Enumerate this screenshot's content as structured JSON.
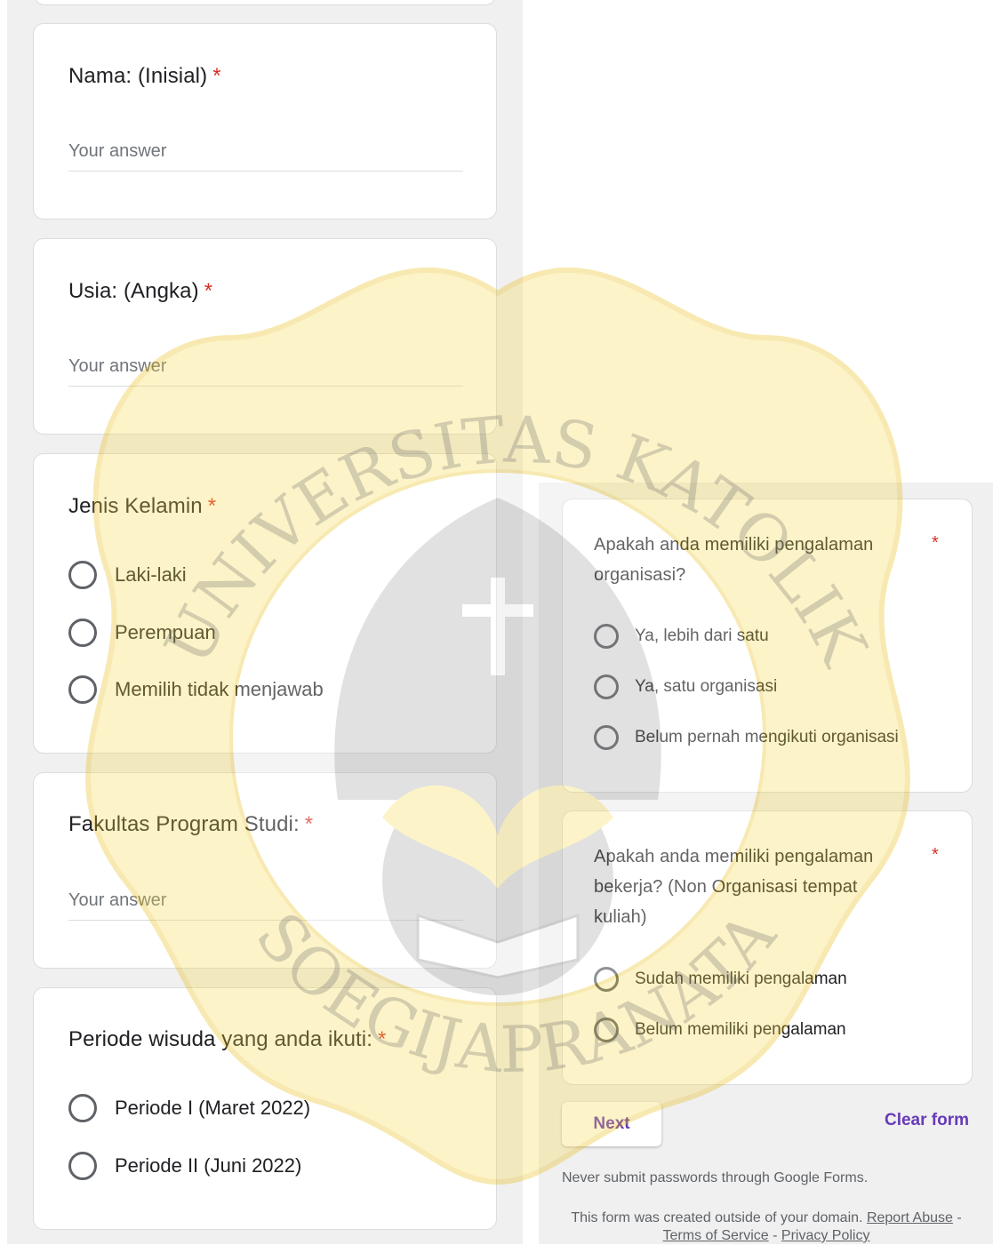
{
  "left": {
    "q_nama": {
      "title": "Nama: (Inisial)",
      "required": "*",
      "placeholder": "Your answer"
    },
    "q_usia": {
      "title": "Usia: (Angka)",
      "required": "*",
      "placeholder": "Your answer"
    },
    "q_jenis_kelamin": {
      "title": "Jenis Kelamin",
      "required": "*",
      "options": [
        "Laki-laki",
        "Perempuan",
        "Memilih tidak menjawab"
      ]
    },
    "q_fakultas": {
      "title": "Fakultas Program Studi:",
      "required": "*",
      "placeholder": "Your answer"
    },
    "q_periode": {
      "title": "Periode wisuda yang anda ikuti:",
      "required": "*",
      "options": [
        "Periode I (Maret 2022)",
        "Periode II (Juni 2022)"
      ]
    }
  },
  "right": {
    "q_organisasi": {
      "title_line1": "Apakah anda memiliki pengalaman",
      "title_line2": "organisasi?",
      "required": "*",
      "options": [
        "Ya, lebih dari satu",
        "Ya, satu organisasi",
        "Belum pernah mengikuti organisasi"
      ]
    },
    "q_bekerja": {
      "title_line1": "Apakah anda memiliki pengalaman",
      "title_line2": "bekerja? (Non Organisasi tempat",
      "title_line3": "kuliah)",
      "required": "*",
      "options": [
        "Sudah memiliki pengalaman",
        "Belum memiliki pengalaman"
      ]
    },
    "next_label": "Next",
    "clear_label": "Clear form",
    "never_submit": "Never submit passwords through Google Forms.",
    "footer_text": "This form was created outside of your domain.",
    "footer_report": "Report Abuse",
    "footer_sep": " - ",
    "footer_terms": "Terms of Service",
    "footer_privacy": "Privacy Policy"
  },
  "watermark": {
    "text_top": "UNIVERSITAS KATOLIK",
    "text_bottom": "SOEGIJAPRANATA"
  },
  "colors": {
    "accent": "#673ab7",
    "required": "#d93025",
    "watermark_yellow": "#f7d94c",
    "watermark_gray": "#9e9e9e"
  }
}
